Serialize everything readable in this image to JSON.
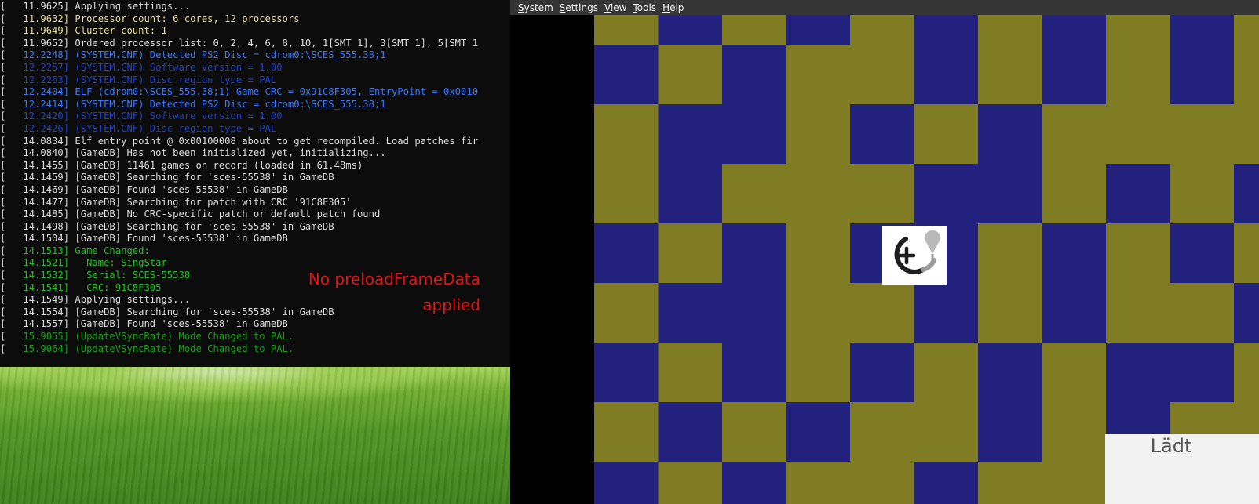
{
  "console": {
    "lines": [
      {
        "t": "   11.9625",
        "msg": "Applying settings...",
        "color": "default"
      },
      {
        "t": "   11.9632",
        "msg": "Processor count: 6 cores, 12 processors",
        "color": "yellow"
      },
      {
        "t": "   11.9649",
        "msg": "Cluster count: 1",
        "color": "yellow"
      },
      {
        "t": "   11.9652",
        "msg": "Ordered processor list: 0, 2, 4, 6, 8, 10, 1[SMT 1], 3[SMT 1], 5[SMT 1",
        "color": "default"
      },
      {
        "t": "   12.2248",
        "msg": "(SYSTEM.CNF) Detected PS2 Disc = cdrom0:\\SCES_555.38;1",
        "color": "blue"
      },
      {
        "t": "   12.2257",
        "msg": "(SYSTEM.CNF) Software version = 1.00",
        "color": "darkblue"
      },
      {
        "t": "   12.2263",
        "msg": "(SYSTEM.CNF) Disc region type = PAL",
        "color": "darkblue"
      },
      {
        "t": "   12.2404",
        "msg": "ELF (cdrom0:\\SCES_555.38;1) Game CRC = 0x91C8F305, EntryPoint = 0x0010",
        "color": "blue"
      },
      {
        "t": "   12.2414",
        "msg": "(SYSTEM.CNF) Detected PS2 Disc = cdrom0:\\SCES_555.38;1",
        "color": "blue"
      },
      {
        "t": "   12.2420",
        "msg": "(SYSTEM.CNF) Software version = 1.00",
        "color": "darkblue"
      },
      {
        "t": "   12.2426",
        "msg": "(SYSTEM.CNF) Disc region type = PAL",
        "color": "darkblue"
      },
      {
        "t": "   14.0834",
        "msg": "Elf entry point @ 0x00100008 about to get recompiled. Load patches fir",
        "color": "default"
      },
      {
        "t": "   14.0840",
        "msg": "[GameDB] Has not been initialized yet, initializing...",
        "color": "default"
      },
      {
        "t": "   14.1455",
        "msg": "[GameDB] 11461 games on record (loaded in 61.48ms)",
        "color": "default"
      },
      {
        "t": "   14.1459",
        "msg": "[GameDB] Searching for 'sces-55538' in GameDB",
        "color": "default"
      },
      {
        "t": "   14.1469",
        "msg": "[GameDB] Found 'sces-55538' in GameDB",
        "color": "default"
      },
      {
        "t": "   14.1477",
        "msg": "[GameDB] Searching for patch with CRC '91C8F305'",
        "color": "default"
      },
      {
        "t": "   14.1485",
        "msg": "[GameDB] No CRC-specific patch or default patch found",
        "color": "default"
      },
      {
        "t": "   14.1498",
        "msg": "[GameDB] Searching for 'sces-55538' in GameDB",
        "color": "default"
      },
      {
        "t": "   14.1504",
        "msg": "[GameDB] Found 'sces-55538' in GameDB",
        "color": "default"
      },
      {
        "t": "   14.1513",
        "msg": "Game Changed:",
        "color": "green"
      },
      {
        "t": "   14.1521",
        "msg": "  Name: SingStar",
        "color": "green"
      },
      {
        "t": "   14.1532",
        "msg": "  Serial: SCES-55538",
        "color": "green"
      },
      {
        "t": "   14.1541",
        "msg": "  CRC: 91C8F305",
        "color": "green"
      },
      {
        "t": "   14.1549",
        "msg": "Applying settings...",
        "color": "default"
      },
      {
        "t": "   14.1554",
        "msg": "[GameDB] Searching for 'sces-55538' in GameDB",
        "color": "default"
      },
      {
        "t": "   14.1557",
        "msg": "[GameDB] Found 'sces-55538' in GameDB",
        "color": "default"
      },
      {
        "t": "   15.9055",
        "msg": "(UpdateVSyncRate) Mode Changed to PAL.",
        "color": "dkgreen"
      },
      {
        "t": "   15.9064",
        "msg": "(UpdateVSyncRate) Mode Changed to PAL.",
        "color": "dkgreen"
      }
    ],
    "colors": {
      "default": "#dcdcdc",
      "yellow": "#e5df9a",
      "blue": "#3b78ff",
      "darkblue": "#1f40c8",
      "green": "#22c022",
      "dkgreen": "#16a016"
    }
  },
  "annotation": {
    "line1": "No preloadFrameData",
    "line2": "applied",
    "color": "#e41414"
  },
  "emulator": {
    "menu": [
      {
        "label": "System",
        "key": "S",
        "rest": "ystem"
      },
      {
        "label": "Settings",
        "key": "S",
        "rest": "ettings"
      },
      {
        "label": "View",
        "key": "V",
        "rest": "iew"
      },
      {
        "label": "Tools",
        "key": "T",
        "rest": "ools"
      },
      {
        "label": "Help",
        "key": "H",
        "rest": "elp"
      }
    ],
    "checker_colors": {
      "olive": "#7f7b22",
      "navy": "#22217e"
    },
    "loading_text": "Lädt",
    "loading_icon": "singstar-loading-icon"
  }
}
